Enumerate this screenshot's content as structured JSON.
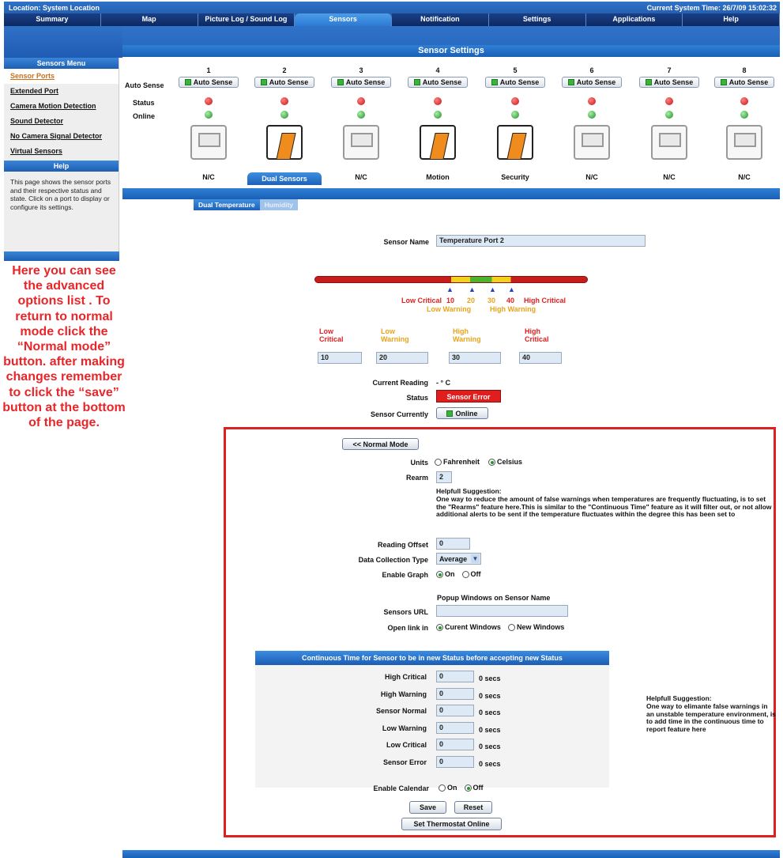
{
  "header": {
    "location": "Location: System Location",
    "time": "Current System Time: 26/7/09 15:02:32"
  },
  "tabs": [
    "Summary",
    "Map",
    "Picture Log / Sound Log",
    "Sensors",
    "Notification",
    "Settings",
    "Applications",
    "Help"
  ],
  "page_title": "Sensor Settings",
  "sidebar": {
    "menu_title": "Sensors Menu",
    "items": [
      "Sensor Ports",
      "Extended Port",
      "Camera Motion Detection",
      "Sound Detector",
      "No Camera Signal Detector",
      "Virtual Sensors"
    ],
    "help_title": "Help",
    "help_text": "This page shows the sensor ports and their respective status and state. Click on a port to display or configure its settings."
  },
  "note": "Here you can see the advanced options list . To return to normal mode click the “Normal mode” button. after making changes remember to click the “save” button at the bottom of the page.",
  "ports": {
    "row_labels": {
      "auto": "Auto Sense",
      "status": "Status",
      "online": "Online"
    },
    "auto_label": "Auto Sense",
    "numbers": [
      "1",
      "2",
      "3",
      "4",
      "5",
      "6",
      "7",
      "8"
    ],
    "types": [
      "N/C",
      "Dual Sensors",
      "N/C",
      "Motion",
      "Security",
      "N/C",
      "N/C",
      "N/C"
    ]
  },
  "subtabs": [
    "Dual Temperature",
    "Humidity"
  ],
  "sensor_name_label": "Sensor Name",
  "sensor_name": "Temperature Port 2",
  "scale": {
    "low_critical": "Low Critical",
    "low_warning": "Low Warning",
    "high_warning": "High Warning",
    "high_critical": "High Critical",
    "v10": "10",
    "v20": "20",
    "v30": "30",
    "v40": "40"
  },
  "thresholds": {
    "labels": [
      [
        "Low",
        "Critical"
      ],
      [
        "Low",
        "Warning"
      ],
      [
        "High",
        "Warning"
      ],
      [
        "High",
        "Critical"
      ]
    ],
    "values": [
      "10",
      "20",
      "30",
      "40"
    ]
  },
  "reading": {
    "current_label": "Current Reading",
    "current_value": "- ° C",
    "status_label": "Status",
    "status_value": "Sensor Error",
    "currently_label": "Sensor Currently",
    "currently_value": "Online"
  },
  "advanced": {
    "normal_mode": "<< Normal Mode",
    "units_label": "Units",
    "fahrenheit": "Fahrenheit",
    "celsius": "Celsius",
    "rearm_label": "Rearm",
    "rearm_value": "2",
    "suggestion_title": "Helpfull Suggestion:",
    "suggestion_text": "One way to reduce the amount of false warnings when temperatures are frequently fluctuating, is to set the \"Rearms\" feature here.This is similar to the \"Continuous Time\" feature as it will filter out, or not allow additional alerts to be sent if the temperature fluctuates within the degree this has been set to",
    "offset_label": "Reading Offset",
    "offset_value": "0",
    "collection_label": "Data Collection Type",
    "collection_value": "Average",
    "graph_label": "Enable Graph",
    "on": "On",
    "off": "Off",
    "popup_label": "Popup Windows on Sensor Name",
    "url_label": "Sensors URL",
    "open_label": "Open link in",
    "current_windows": "Curent Windows",
    "new_windows": "New Windows"
  },
  "continuous": {
    "title": "Continuous Time for Sensor to be in new Status before accepting new Status",
    "rows": [
      {
        "label": "High Critical",
        "value": "0",
        "unit": "0 secs"
      },
      {
        "label": "High Warning",
        "value": "0",
        "unit": "0 secs"
      },
      {
        "label": "Sensor Normal",
        "value": "0",
        "unit": "0 secs"
      },
      {
        "label": "Low Warning",
        "value": "0",
        "unit": "0 secs"
      },
      {
        "label": "Low Critical",
        "value": "0",
        "unit": "0 secs"
      },
      {
        "label": "Sensor Error",
        "value": "0",
        "unit": "0 secs"
      }
    ],
    "calendar_label": "Enable Calendar",
    "suggestion_title": "Helpfull Suggestion:",
    "suggestion_text": "One way to elimante false warnings in an unstable temperature environment, is to add time in the continuous time to report feature here"
  },
  "buttons": {
    "save": "Save",
    "reset": "Reset",
    "thermostat": "Set Thermostat Online"
  }
}
